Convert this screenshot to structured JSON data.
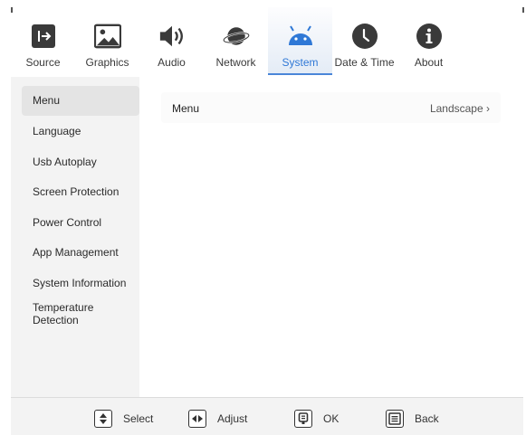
{
  "nav": {
    "tabs": [
      {
        "label": "Source",
        "icon": "source-icon"
      },
      {
        "label": "Graphics",
        "icon": "image-icon"
      },
      {
        "label": "Audio",
        "icon": "speaker-icon"
      },
      {
        "label": "Network",
        "icon": "planet-icon"
      },
      {
        "label": "System",
        "icon": "android-icon",
        "active": true
      },
      {
        "label": "Date & Time",
        "icon": "clock-icon"
      },
      {
        "label": "About",
        "icon": "info-icon"
      }
    ],
    "active_color": "#2f78d6"
  },
  "sidebar": {
    "items": [
      {
        "label": "Menu",
        "selected": true
      },
      {
        "label": "Language"
      },
      {
        "label": "Usb Autoplay"
      },
      {
        "label": "Screen Protection"
      },
      {
        "label": "Power Control"
      },
      {
        "label": "App Management"
      },
      {
        "label": "System Information"
      },
      {
        "label": "Temperature Detection"
      }
    ]
  },
  "content": {
    "rows": [
      {
        "label": "Menu",
        "value": "Landscape",
        "chevron": "›"
      }
    ]
  },
  "footer": {
    "hints": [
      {
        "label": "Select",
        "icon": "up-down-icon"
      },
      {
        "label": "Adjust",
        "icon": "left-right-icon"
      },
      {
        "label": "OK",
        "icon": "ok-button-icon"
      },
      {
        "label": "Back",
        "icon": "back-list-icon"
      }
    ]
  }
}
